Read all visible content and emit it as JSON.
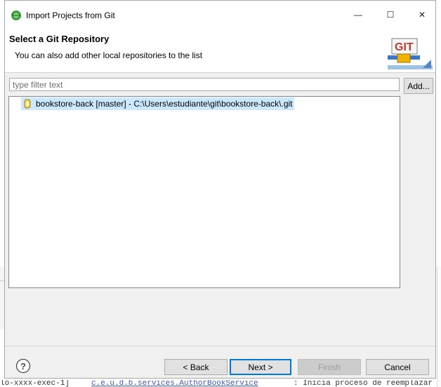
{
  "window": {
    "title": "Import Projects from Git",
    "minimize_glyph": "—",
    "maximize_glyph": "☐",
    "close_glyph": "✕"
  },
  "header": {
    "title": "Select a Git Repository",
    "subtitle": "You can also add other local repositories to the list",
    "logo_text": "GIT"
  },
  "filter": {
    "placeholder": "type filter text",
    "value": ""
  },
  "add_button_label": "Add...",
  "repositories": [
    {
      "label": "bookstore-back [master] - C:\\Users\\estudiante\\git\\bookstore-back\\.git",
      "selected": true,
      "icon": "git-repository-icon"
    }
  ],
  "footer": {
    "help_icon": "help-icon",
    "back_label": "< Back",
    "next_label": "Next >",
    "finish_label": "Finish",
    "cancel_label": "Cancel",
    "finish_enabled": false
  },
  "background": {
    "left_code": "lo-xxxx-exec-1]",
    "left_link": "c.e.u.d.b.services.AuthorBookService",
    "right_text": ": Inicia proceso de reemplazar"
  },
  "colors": {
    "selection": "#cce8ff",
    "default_button_border": "#0078d7",
    "dialog_bg": "#f0f0f0"
  }
}
